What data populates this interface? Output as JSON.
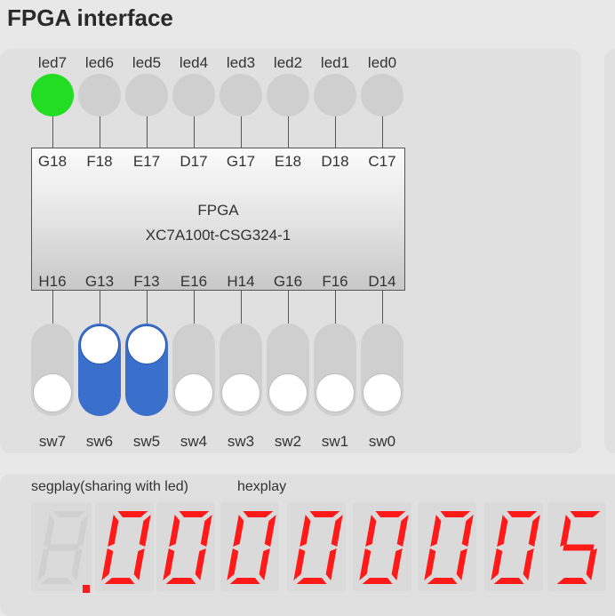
{
  "title": "FPGA interface",
  "leds": [
    {
      "label": "led7",
      "on": true
    },
    {
      "label": "led6",
      "on": false
    },
    {
      "label": "led5",
      "on": false
    },
    {
      "label": "led4",
      "on": false
    },
    {
      "label": "led3",
      "on": false
    },
    {
      "label": "led2",
      "on": false
    },
    {
      "label": "led1",
      "on": false
    },
    {
      "label": "led0",
      "on": false
    }
  ],
  "led_pins": [
    "G18",
    "F18",
    "E17",
    "D17",
    "G17",
    "E18",
    "D18",
    "C17"
  ],
  "chip": {
    "name": "FPGA",
    "part": "XC7A100t-CSG324-1"
  },
  "switch_pins": [
    "H16",
    "G13",
    "F13",
    "E16",
    "H14",
    "G16",
    "F16",
    "D14"
  ],
  "switches": [
    {
      "label": "sw7",
      "on": false
    },
    {
      "label": "sw6",
      "on": true
    },
    {
      "label": "sw5",
      "on": true
    },
    {
      "label": "sw4",
      "on": false
    },
    {
      "label": "sw3",
      "on": false
    },
    {
      "label": "sw2",
      "on": false
    },
    {
      "label": "sw1",
      "on": false
    },
    {
      "label": "sw0",
      "on": false
    }
  ],
  "display": {
    "segplay_label": "segplay(sharing with led)",
    "hexplay_label": "hexplay",
    "digits": [
      "0",
      "0",
      "0",
      "0",
      "0",
      "0",
      "0",
      "5"
    ]
  },
  "colors": {
    "led_on": "#22dd22",
    "led_off": "#cfcfcf",
    "switch_on": "#3a6fcc",
    "segment_on": "#ff1a1a",
    "segment_off": "#d0d0d0"
  }
}
